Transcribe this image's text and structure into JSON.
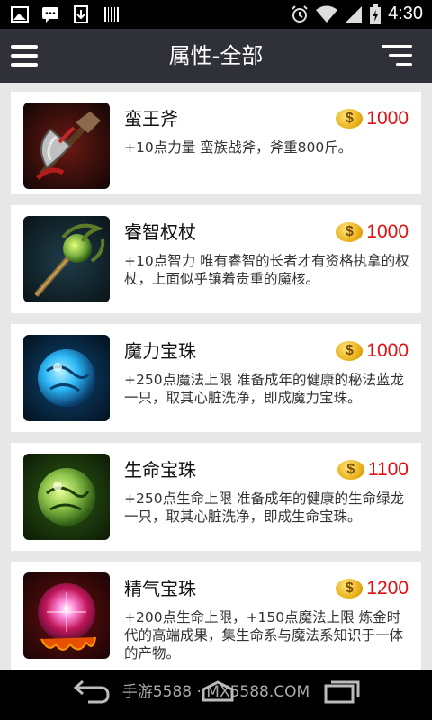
{
  "status_bar": {
    "time": "4:30",
    "icons": [
      "image-icon",
      "chat-icon",
      "download-icon",
      "barcode-icon",
      "alarm-icon",
      "wifi-icon",
      "signal-icon",
      "battery-icon"
    ]
  },
  "header": {
    "title": "属性-全部",
    "menu_icon": "menu-icon",
    "sort_icon": "sort-icon"
  },
  "items": [
    {
      "name": "蛮王斧",
      "price": "1000",
      "desc": "+10点力量 蛮族战斧，斧重800斤。",
      "icon": "axe-icon",
      "accent": "#c62828"
    },
    {
      "name": "睿智权杖",
      "price": "1000",
      "desc": "+10点智力 唯有睿智的长者才有资格执拿的权杖，上面似乎镶着贵重的魔核。",
      "icon": "scepter-icon",
      "accent": "#7cb342"
    },
    {
      "name": "魔力宝珠",
      "price": "1000",
      "desc": "+250点魔法上限 准备成年的健康的秘法蓝龙一只，取其心脏洗净，即成魔力宝珠。",
      "icon": "blue-orb-icon",
      "accent": "#29b6f6"
    },
    {
      "name": "生命宝珠",
      "price": "1100",
      "desc": "+250点生命上限 准备成年的健康的生命绿龙一只，取其心脏洗净，即成生命宝珠。",
      "icon": "green-orb-icon",
      "accent": "#7cb342"
    },
    {
      "name": "精气宝珠",
      "price": "1200",
      "desc": "+200点生命上限，+150点魔法上限 炼金时代的高端成果，集生命系与魔法系知识于一体的产物。",
      "icon": "red-orb-icon",
      "accent": "#e53935"
    }
  ],
  "price_color": "#e01010",
  "coin_symbol": "$",
  "nav_bar": {
    "watermark": "手游5588 · MX5588.COM",
    "icons": [
      "back-icon",
      "home-icon",
      "recent-apps-icon"
    ]
  }
}
